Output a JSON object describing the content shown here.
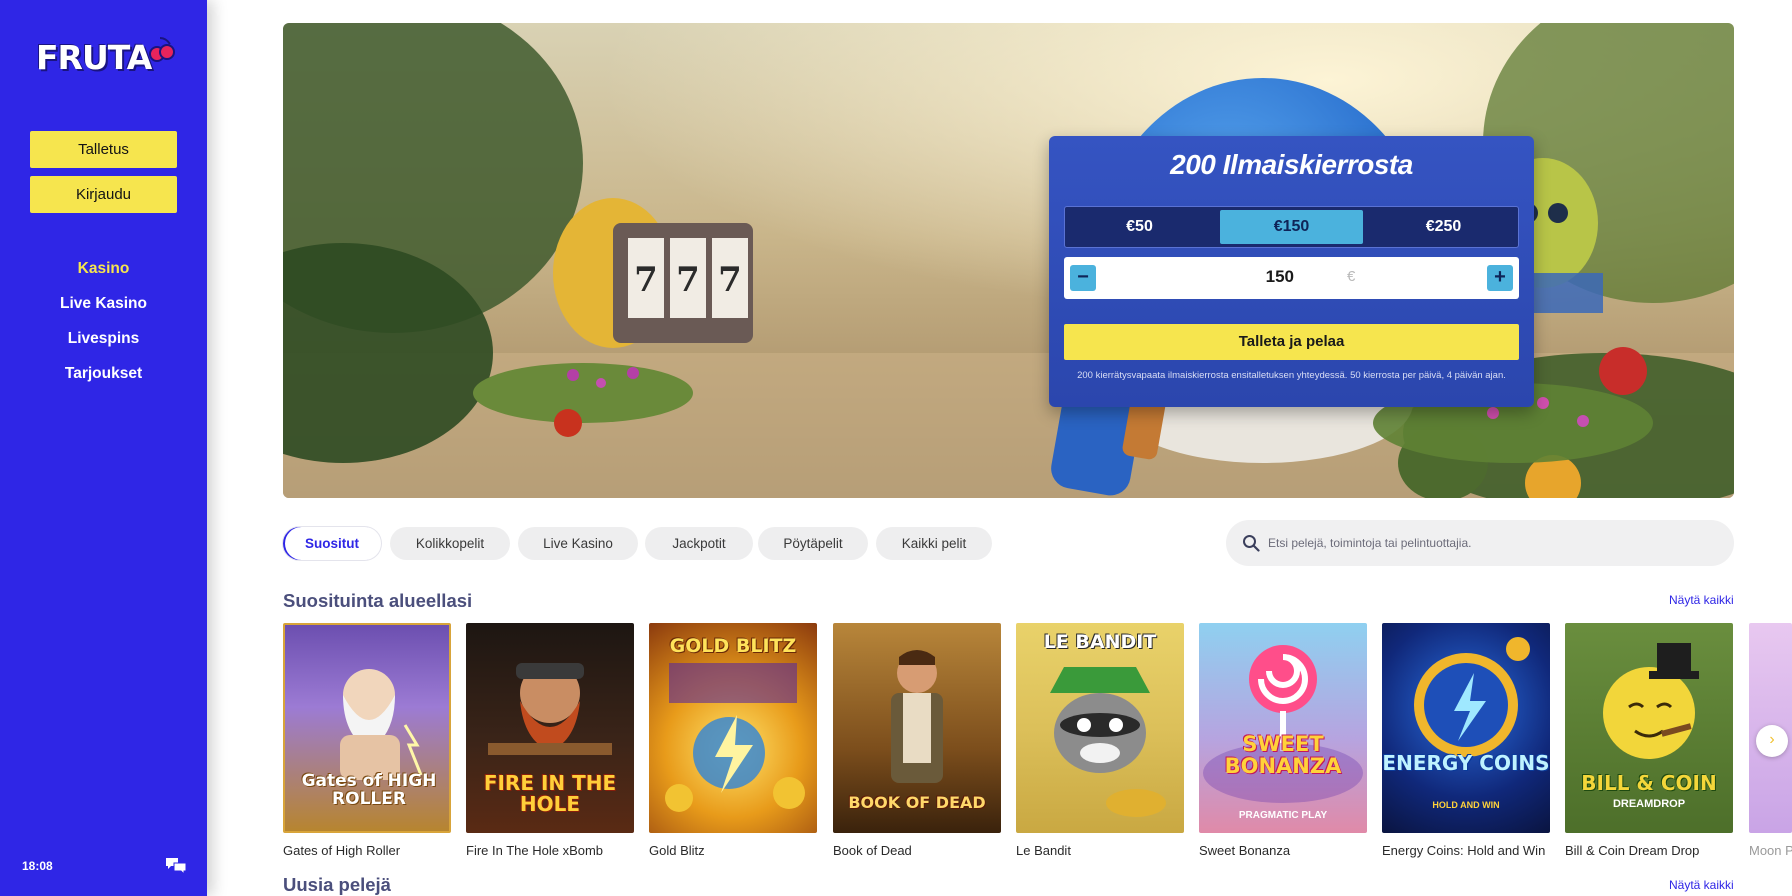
{
  "sidebar": {
    "logo_text": "FRUTA",
    "deposit_label": "Talletus",
    "login_label": "Kirjaudu",
    "nav": [
      {
        "label": "Kasino",
        "active": true
      },
      {
        "label": "Live Kasino",
        "active": false
      },
      {
        "label": "Livespins",
        "active": false
      },
      {
        "label": "Tarjoukset",
        "active": false
      }
    ],
    "time": "18:08",
    "chat_icon": "chat-icon",
    "brand_color": "#2f26e6",
    "accent_color": "#f6e54e"
  },
  "hero": {
    "promo_title_number": "200",
    "promo_title_text": "Ilmaiskierrosta",
    "amounts": [
      "€50",
      "€150",
      "€250"
    ],
    "selected_amount": "€150",
    "stepper_value": "150",
    "currency": "€",
    "minus_label": "−",
    "plus_label": "+",
    "cta_label": "Talleta ja pelaa",
    "terms": "200 kierrätysvapaata ilmaiskierrosta ensitalletuksen yhteydessä. 50 kierrosta per päivä, 4 päivän ajan."
  },
  "filters": {
    "chips": [
      "Suositut",
      "Kolikkopelit",
      "Live Kasino",
      "Jackpotit",
      "Pöytäpelit",
      "Kaikki pelit"
    ],
    "active": "Suositut",
    "search_placeholder": "Etsi pelejä, toimintoja tai pelintuottajia."
  },
  "sections": {
    "popular_title": "Suosituinta alueellasi",
    "popular_see_all": "Näytä kaikki",
    "new_title": "Uusia pelejä",
    "new_see_all": "Näytä kaikki"
  },
  "games": [
    {
      "name": "Gates of High Roller",
      "logo": "Gates of HIGH ROLLER"
    },
    {
      "name": "Fire In The Hole xBomb",
      "logo": "FIRE IN THE HOLE"
    },
    {
      "name": "Gold Blitz",
      "logo": "GOLD BLITZ"
    },
    {
      "name": "Book of Dead",
      "logo": "BOOK OF DEAD"
    },
    {
      "name": "Le Bandit",
      "logo": "LE BANDIT"
    },
    {
      "name": "Sweet Bonanza",
      "logo": "SWEET BONANZA",
      "sub": "PRAGMATIC PLAY"
    },
    {
      "name": "Energy Coins: Hold and Win",
      "logo": "ENERGY COINS",
      "sub": "HOLD AND WIN"
    },
    {
      "name": "Bill & Coin Dream Drop",
      "logo": "BILL & COIN",
      "sub": "DREAMDROP"
    },
    {
      "name": "Moon Princess",
      "logo": ""
    }
  ],
  "carousel_next_icon": "chevron-right-icon"
}
